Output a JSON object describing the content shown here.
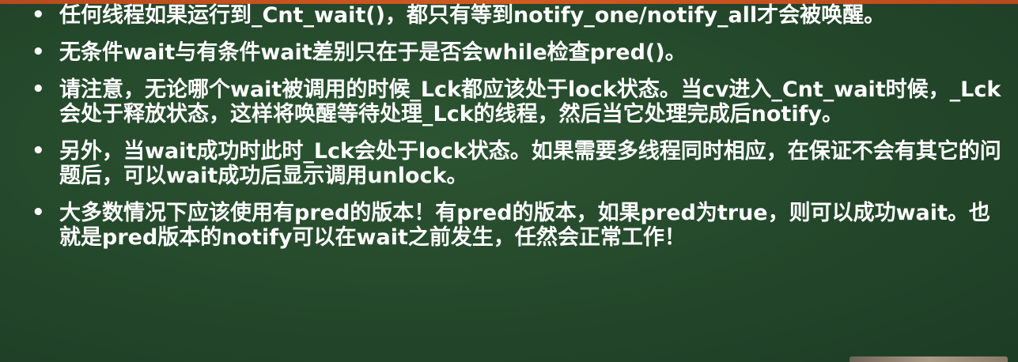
{
  "bullets": [
    {
      "text": "任何线程如果运行到_Cnt_wait()，都只有等到notify_one/notify_all才会被唤醒。"
    },
    {
      "text": "无条件wait与有条件wait差别只在于是否会while检查pred()。"
    },
    {
      "text": "请注意，无论哪个wait被调用的时候_Lck都应该处于lock状态。当cv进入_Cnt_wait时候，_Lck会处于释放状态，这样将唤醒等待处理_Lck的线程，然后当它处理完成后notify。"
    },
    {
      "text": "另外，当wait成功时此时_Lck会处于lock状态。如果需要多线程同时相应，在保证不会有其它的问题后，可以wait成功后显示调用unlock。"
    },
    {
      "text": "大多数情况下应该使用有pred的版本！有pred的版本，如果pred为true，则可以成功wait。也就是pred版本的notify可以在wait之前发生，任然会正常工作！"
    }
  ],
  "colors": {
    "background": "#244a2b",
    "text": "#ffffff",
    "accent_bar": "#d25a23"
  }
}
